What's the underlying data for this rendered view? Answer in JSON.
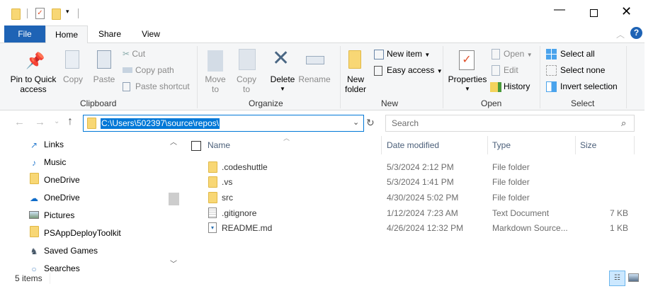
{
  "title_bar": {
    "controls": [
      "minimize",
      "maximize",
      "close"
    ]
  },
  "tabs": [
    {
      "label": "File"
    },
    {
      "label": "Home"
    },
    {
      "label": "Share"
    },
    {
      "label": "View"
    }
  ],
  "ribbon": {
    "clipboard": {
      "label": "Clipboard",
      "pin": "Pin to Quick access",
      "pin_l1": "Pin to Quick",
      "pin_l2": "access",
      "copy": "Copy",
      "paste": "Paste",
      "cut": "Cut",
      "copy_path": "Copy path",
      "paste_shortcut": "Paste shortcut"
    },
    "organize": {
      "label": "Organize",
      "move_l1": "Move",
      "move_l2": "to",
      "copy_l1": "Copy",
      "copy_l2": "to",
      "delete": "Delete",
      "rename": "Rename"
    },
    "new": {
      "label": "New",
      "new_folder_l1": "New",
      "new_folder_l2": "folder",
      "new_item": "New item",
      "easy_access": "Easy access"
    },
    "open": {
      "label": "Open",
      "properties": "Properties",
      "open": "Open",
      "edit": "Edit",
      "history": "History"
    },
    "select": {
      "label": "Select",
      "select_all": "Select all",
      "select_none": "Select none",
      "invert": "Invert selection"
    }
  },
  "address": {
    "path": "C:\\Users\\502397\\source\\repos\\",
    "search_placeholder": "Search"
  },
  "nav": [
    {
      "label": "Links",
      "icon": "links-icon"
    },
    {
      "label": "Music",
      "icon": "music-icon"
    },
    {
      "label": "OneDrive",
      "icon": "folder-icon"
    },
    {
      "label": "OneDrive",
      "icon": "cloud-icon"
    },
    {
      "label": "Pictures",
      "icon": "pictures-icon"
    },
    {
      "label": "PSAppDeployToolkit",
      "icon": "folder-icon"
    },
    {
      "label": "Saved Games",
      "icon": "saved-games-icon"
    },
    {
      "label": "Searches",
      "icon": "search-icon"
    }
  ],
  "columns": {
    "name": "Name",
    "date": "Date modified",
    "type": "Type",
    "size": "Size"
  },
  "files": [
    {
      "name": ".codeshuttle",
      "date": "5/3/2024 2:12 PM",
      "type": "File folder",
      "size": ""
    },
    {
      "name": ".vs",
      "date": "5/3/2024 1:41 PM",
      "type": "File folder",
      "size": ""
    },
    {
      "name": "src",
      "date": "4/30/2024 5:02 PM",
      "type": "File folder",
      "size": ""
    },
    {
      "name": ".gitignore",
      "date": "1/12/2024 7:23 AM",
      "type": "Text Document",
      "size": "7 KB"
    },
    {
      "name": "README.md",
      "date": "4/26/2024 12:32 PM",
      "type": "Markdown Source...",
      "size": "1 KB"
    }
  ],
  "status": {
    "count": "5 items"
  },
  "colors": {
    "file_tab": "#1e63b5",
    "accent": "#0078d7",
    "selection": "#0078d7"
  }
}
